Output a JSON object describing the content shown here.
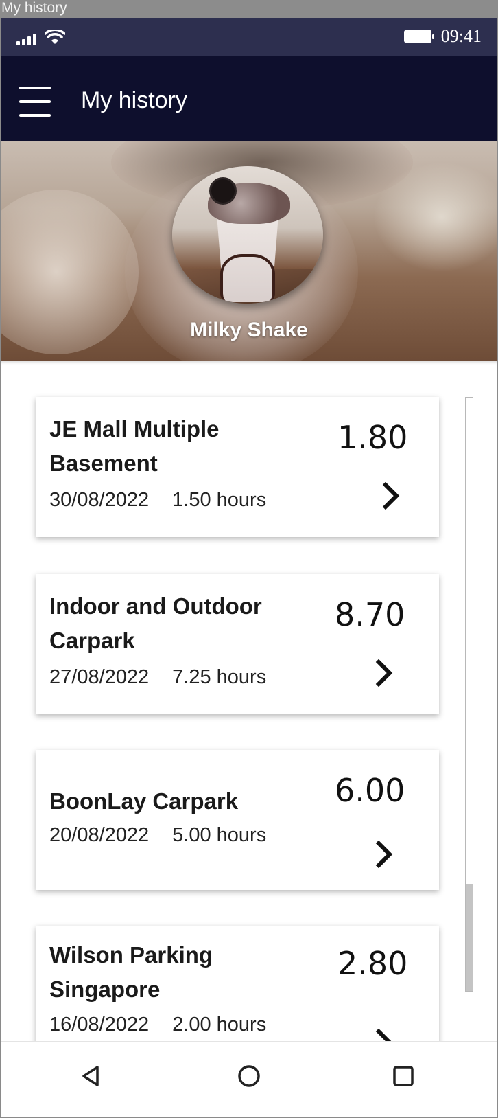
{
  "window": {
    "title": "My history"
  },
  "status_bar": {
    "time": "09:41"
  },
  "app_bar": {
    "title": "My history",
    "menu_icon": "hamburger-menu-icon"
  },
  "profile": {
    "name": "Milky Shake",
    "avatar_image": "milkshake-photo"
  },
  "history": [
    {
      "location_line1": "JE Mall Multiple",
      "location_line2": "Basement",
      "date": "30/08/2022",
      "duration": "1.50 hours",
      "amount": "1.80"
    },
    {
      "location_line1": "Indoor and Outdoor",
      "location_line2": "Carpark",
      "date": "27/08/2022",
      "duration": "7.25 hours",
      "amount": "8.70"
    },
    {
      "location_line1": "BoonLay Carpark",
      "location_line2": "",
      "date": "20/08/2022",
      "duration": "5.00 hours",
      "amount": "6.00"
    },
    {
      "location_line1": "Wilson Parking",
      "location_line2": "Singapore",
      "date": "16/08/2022",
      "duration": "2.00 hours",
      "amount": "2.80"
    }
  ],
  "scroll": {
    "position": 0.82
  },
  "nav_bar": {
    "back_icon": "back-triangle-icon",
    "home_icon": "home-circle-icon",
    "recents_icon": "recents-square-icon"
  },
  "colors": {
    "status_bar": "#2d2f4f",
    "app_bar": "#0e0f2d",
    "card_bg": "#ffffff"
  }
}
